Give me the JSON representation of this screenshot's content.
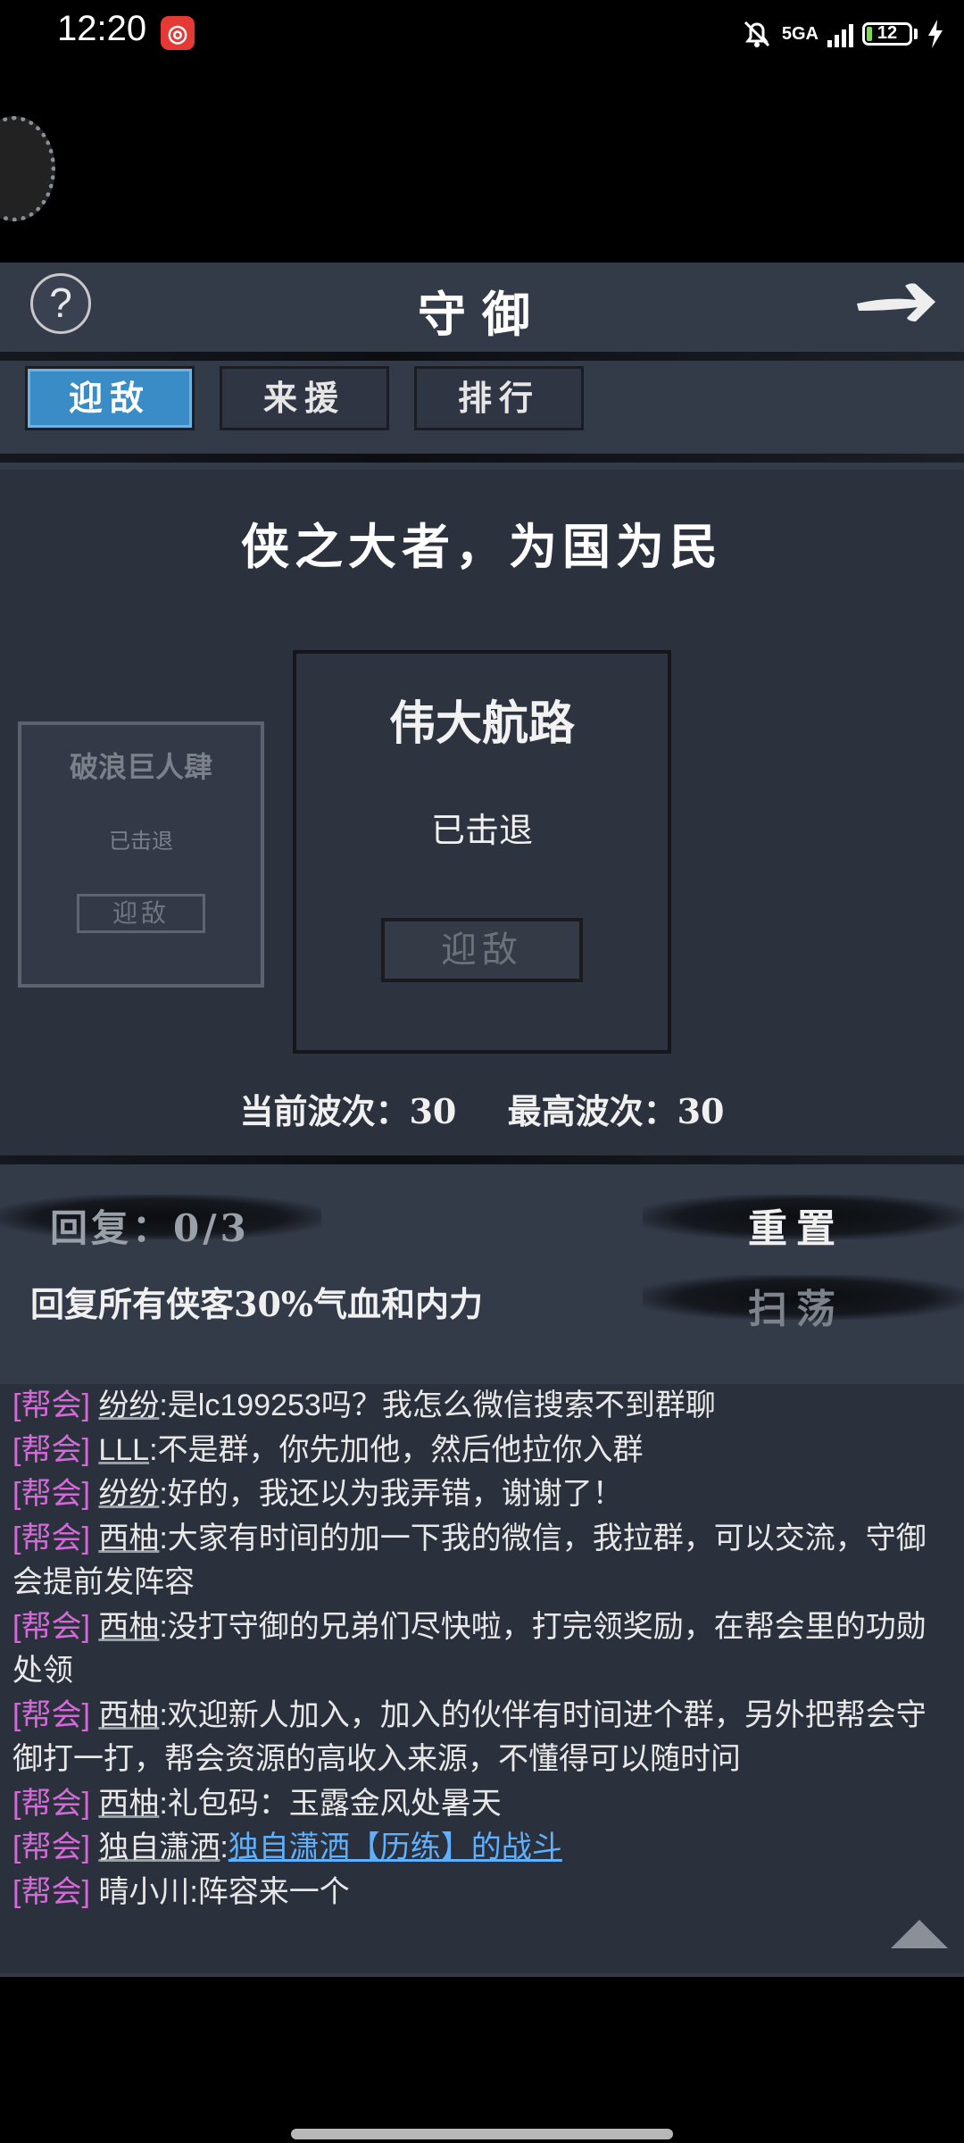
{
  "status_bar": {
    "time": "12:20",
    "notification_app_icon": "red-app-icon",
    "network": "5GA",
    "battery": "12",
    "battery_level_percent": 12
  },
  "header": {
    "title": "守御"
  },
  "tabs": [
    {
      "label": "迎敌",
      "active": true
    },
    {
      "label": "来援",
      "active": false
    },
    {
      "label": "排行",
      "active": false
    }
  ],
  "motto": "侠之大者，为国为民",
  "cards": {
    "side": {
      "name": "破浪巨人肆",
      "status": "已击退",
      "button": "迎敌"
    },
    "main": {
      "name": "伟大航路",
      "status": "已击退",
      "button": "迎敌"
    }
  },
  "waves": {
    "current": "当前波次：30",
    "best": "最高波次：30"
  },
  "recovery": {
    "label": "回复：0/3",
    "description": "回复所有侠客30%气血和内力",
    "reset_button": "重置",
    "sweep_button": "扫荡"
  },
  "chat": [
    {
      "channel": "[帮会]",
      "name": "纷纷",
      "text": ":是lc199253吗？我怎么微信搜索不到群聊"
    },
    {
      "channel": "[帮会]",
      "name": "LLL",
      "text": ":不是群，你先加他，然后他拉你入群"
    },
    {
      "channel": "[帮会]",
      "name": "纷纷",
      "text": ":好的，我还以为我弄错，谢谢了！"
    },
    {
      "channel": "[帮会]",
      "name": "西柚",
      "text": ":大家有时间的加一下我的微信，我拉群，可以交流，守御会提前发阵容"
    },
    {
      "channel": "[帮会]",
      "name": "西柚",
      "text": ":没打守御的兄弟们尽快啦，打完领奖励，在帮会里的功勋处领"
    },
    {
      "channel": "[帮会]",
      "name": "西柚",
      "text": ":欢迎新人加入，加入的伙伴有时间进个群，另外把帮会守御打一打，帮会资源的高收入来源，不懂得可以随时问"
    },
    {
      "channel": "[帮会]",
      "name": "西柚",
      "text": ":礼包码：玉露金风处暑天"
    },
    {
      "channel": "[帮会]",
      "name": "独自潇洒",
      "text": ":",
      "link": "独自潇洒【历练】的战斗"
    },
    {
      "channel": "[帮会]",
      "name": "晴小川",
      "text": ":阵容来一个"
    }
  ],
  "colors": {
    "panel": "#333a48",
    "active_tab": "#3a8cc7",
    "channel": "#d36ad8",
    "link": "#5fb0ff"
  }
}
